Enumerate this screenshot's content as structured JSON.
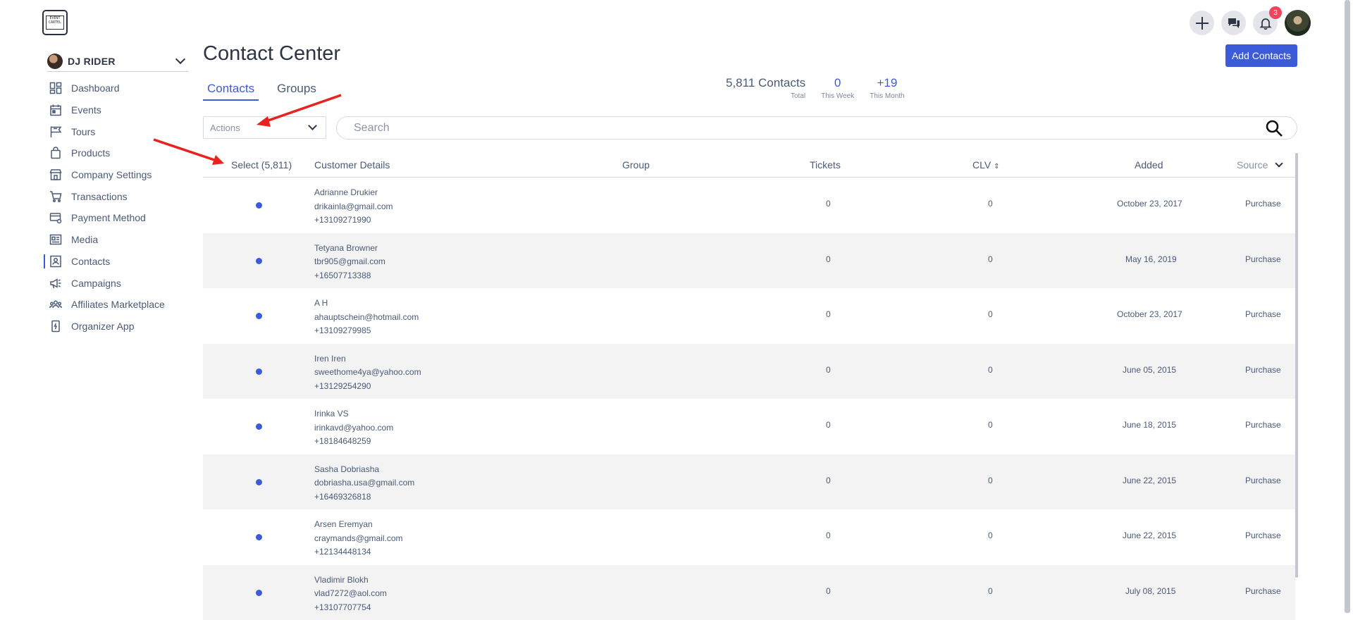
{
  "brand": {
    "logo_text": "EVENT CARTEL"
  },
  "org": {
    "name": "DJ RIDER"
  },
  "nav": [
    {
      "label": "Dashboard",
      "icon": "dashboard-icon"
    },
    {
      "label": "Events",
      "icon": "calendar-icon"
    },
    {
      "label": "Tours",
      "icon": "flag-icon"
    },
    {
      "label": "Products",
      "icon": "bag-icon"
    },
    {
      "label": "Company Settings",
      "icon": "store-icon"
    },
    {
      "label": "Transactions",
      "icon": "cart-icon"
    },
    {
      "label": "Payment Method",
      "icon": "card-gear-icon"
    },
    {
      "label": "Media",
      "icon": "media-icon"
    },
    {
      "label": "Contacts",
      "icon": "contact-card-icon"
    },
    {
      "label": "Campaigns",
      "icon": "megaphone-icon"
    },
    {
      "label": "Affiliates Marketplace",
      "icon": "people-icon"
    },
    {
      "label": "Organizer App",
      "icon": "phone-icon"
    }
  ],
  "page": {
    "title": "Contact Center"
  },
  "tabs": [
    "Contacts",
    "Groups"
  ],
  "stats": {
    "total_value": "5,811 Contacts",
    "total_label": "Total",
    "week_value": "0",
    "week_label": "This Week",
    "month_value": "+19",
    "month_label": "This Month"
  },
  "add_contacts_label": "Add Contacts",
  "actions_placeholder": "Actions",
  "search_placeholder": "Search",
  "notifications_count": "3",
  "table": {
    "headers": {
      "select": "Select (5,811)",
      "details": "Customer Details",
      "group": "Group",
      "tickets": "Tickets",
      "clv": "CLV",
      "added": "Added",
      "source": "Source"
    },
    "rows": [
      {
        "name": "Adrianne Drukier",
        "email": "drikainla@gmail.com",
        "phone": "+13109271990",
        "group": "",
        "tickets": "0",
        "clv": "0",
        "added": "October 23, 2017",
        "source": "Purchase"
      },
      {
        "name": "Tetyana Browner",
        "email": "tbr905@gmail.com",
        "phone": "+16507713388",
        "group": "",
        "tickets": "0",
        "clv": "0",
        "added": "May 16, 2019",
        "source": "Purchase"
      },
      {
        "name": "A H",
        "email": "ahauptschein@hotmail.com",
        "phone": "+13109279985",
        "group": "",
        "tickets": "0",
        "clv": "0",
        "added": "October 23, 2017",
        "source": "Purchase"
      },
      {
        "name": "Iren Iren",
        "email": "sweethome4ya@yahoo.com",
        "phone": "+13129254290",
        "group": "",
        "tickets": "0",
        "clv": "0",
        "added": "June 05, 2015",
        "source": "Purchase"
      },
      {
        "name": "Irinka VS",
        "email": "irinkavd@yahoo.com",
        "phone": "+18184648259",
        "group": "",
        "tickets": "0",
        "clv": "0",
        "added": "June 18, 2015",
        "source": "Purchase"
      },
      {
        "name": "Sasha Dobriasha",
        "email": "dobriasha.usa@gmail.com",
        "phone": "+16469326818",
        "group": "",
        "tickets": "0",
        "clv": "0",
        "added": "June 22, 2015",
        "source": "Purchase"
      },
      {
        "name": "Arsen Eremyan",
        "email": "craymands@gmail.com",
        "phone": "+12134448134",
        "group": "",
        "tickets": "0",
        "clv": "0",
        "added": "June 22, 2015",
        "source": "Purchase"
      },
      {
        "name": "Vladimir Blokh",
        "email": "vlad7272@aol.com",
        "phone": "+13107707754",
        "group": "",
        "tickets": "0",
        "clv": "0",
        "added": "July 08, 2015",
        "source": "Purchase"
      }
    ]
  },
  "colors": {
    "accent": "#3b5bdb",
    "badge": "#f0455a",
    "annotation": "#e8231f"
  }
}
